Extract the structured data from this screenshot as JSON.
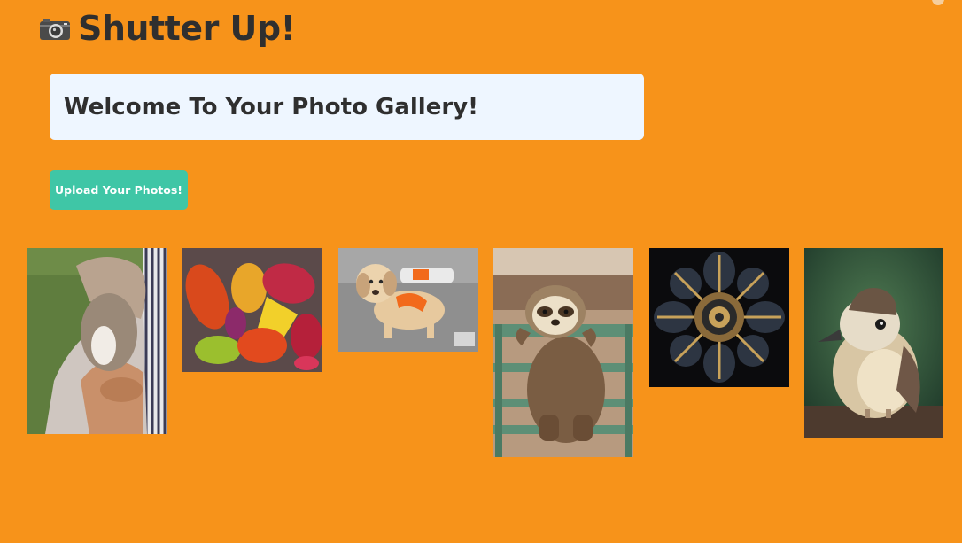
{
  "app": {
    "title": "Shutter Up!",
    "icon": "camera-icon"
  },
  "welcome": {
    "heading": "Welcome To Your Photo Gallery!"
  },
  "upload": {
    "label": "Upload Your Photos!"
  },
  "gallery": {
    "photos": [
      {
        "subject": "squirrel"
      },
      {
        "subject": "autumn-leaves"
      },
      {
        "subject": "puppy"
      },
      {
        "subject": "sloth"
      },
      {
        "subject": "kaleidoscope"
      },
      {
        "subject": "kookaburra"
      }
    ]
  },
  "colors": {
    "background": "#f7931a",
    "card": "#eef6ff",
    "button": "#3fc6a6",
    "text": "#2f2f2f"
  }
}
